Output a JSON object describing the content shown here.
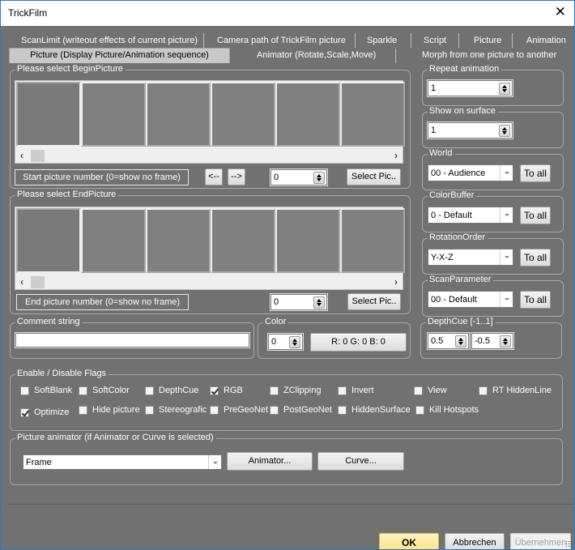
{
  "window": {
    "title": "TrickFilm",
    "close_icon": "close-icon"
  },
  "tabs": {
    "row1": [
      {
        "label": "ScanLimit (writeout effects of current picture)"
      },
      {
        "label": "Camera path of TrickFilm picture"
      },
      {
        "label": "Sparkle"
      },
      {
        "label": "Script"
      },
      {
        "label": "Picture"
      },
      {
        "label": "Animation"
      }
    ],
    "row2": [
      {
        "label": "Picture (Display Picture/Animation sequence)",
        "active": true
      },
      {
        "label": "Animator (Rotate,Scale,Move)"
      },
      {
        "label": "Morph from one picture to another"
      }
    ]
  },
  "begin_picture": {
    "group_label": "Please select BeginPicture",
    "info_label": "Start picture number (0=show no frame)",
    "prev_label": "<--",
    "next_label": "-->",
    "number_value": "0",
    "select_label": "Select Pic.."
  },
  "end_picture": {
    "group_label": "Please select EndPicture",
    "info_label": "End picture number (0=show no frame)",
    "number_value": "0",
    "select_label": "Select Pic.."
  },
  "comment": {
    "group_label": "Comment string",
    "value": ""
  },
  "color": {
    "group_label": "Color",
    "index_value": "0",
    "rgb_label": "R: 0 G: 0 B: 0"
  },
  "right_panel": {
    "repeat": {
      "label": "Repeat animation",
      "value": "1"
    },
    "surface": {
      "label": "Show on surface",
      "value": "1"
    },
    "world": {
      "label": "World",
      "value": "00 - Audience",
      "button": "To all"
    },
    "colorbuffer": {
      "label": "ColorBuffer",
      "value": "0 - Default",
      "button": "To all"
    },
    "rotation": {
      "label": "RotationOrder",
      "value": "Y-X-Z",
      "button": "To all"
    },
    "scan": {
      "label": "ScanParameter",
      "value": "00 - Default",
      "button": "To all"
    },
    "depthcue": {
      "label": "DepthCue [-1..1]",
      "value1": "0.5",
      "value2": "-0.5"
    }
  },
  "flags": {
    "group_label": "Enable / Disable Flags",
    "items": [
      {
        "label": "SoftBlank",
        "checked": false
      },
      {
        "label": "SoftColor",
        "checked": false
      },
      {
        "label": "DepthCue",
        "checked": false
      },
      {
        "label": "RGB",
        "checked": true
      },
      {
        "label": "ZClipping",
        "checked": false
      },
      {
        "label": "Invert",
        "checked": false
      },
      {
        "label": "View",
        "checked": false
      },
      {
        "label": "RT HiddenLine",
        "checked": false
      },
      {
        "label": "Optimize",
        "checked": true
      },
      {
        "label": "Hide picture",
        "checked": false
      },
      {
        "label": "Stereografic",
        "checked": false
      },
      {
        "label": "PreGeoNet",
        "checked": false
      },
      {
        "label": "PostGeoNet",
        "checked": false
      },
      {
        "label": "HiddenSurface",
        "checked": false
      },
      {
        "label": "Kill Hotspots",
        "checked": false
      }
    ]
  },
  "animator": {
    "group_label": "Picture animator (if Animator or Curve is selected)",
    "mode_value": "Frame",
    "animator_button": "Animator...",
    "curve_button": "Curve..."
  },
  "footer": {
    "ok": "OK",
    "cancel": "Abbrechen",
    "apply": "Übernehmen"
  }
}
